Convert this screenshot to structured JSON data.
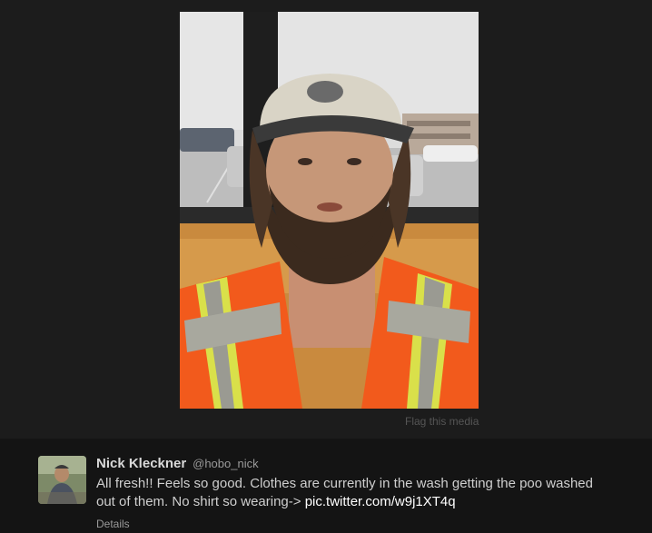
{
  "media": {
    "flag_label": "Flag this media",
    "alt": "Bearded man in a cap and orange high-visibility vest"
  },
  "tweet": {
    "author_name": "Nick Kleckner",
    "author_handle": "@hobo_nick",
    "text": "All fresh!! Feels so good. Clothes are currently in the wash getting the poo washed out of them. No shirt so wearing->",
    "link_label": "pic.twitter.com/w9j1XT4q",
    "details_label": "Details"
  },
  "colors": {
    "background": "#1c1c1c",
    "tweet_bar": "#141414",
    "vest_orange": "#f25a1c",
    "reflective_yellow": "#d9e04a"
  }
}
